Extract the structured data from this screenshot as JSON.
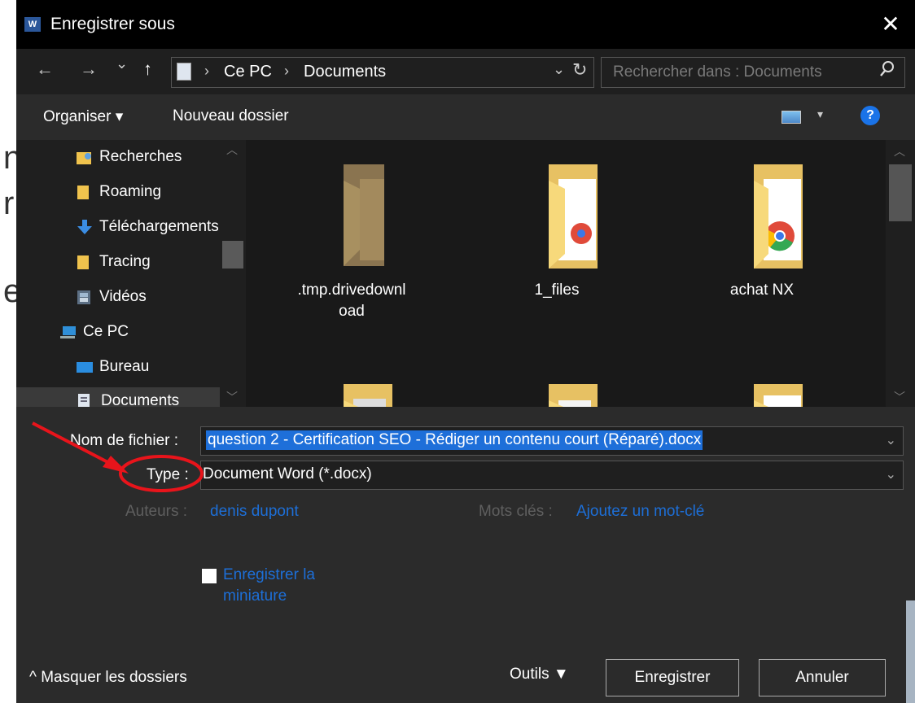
{
  "background": {
    "fragments": [
      "n",
      "r",
      "e"
    ]
  },
  "window": {
    "app_icon_text": "W",
    "title": "Enregistrer sous",
    "close": "✕"
  },
  "nav": {
    "back": "←",
    "forward": "→",
    "recent": "⌄",
    "up": "↑",
    "breadcrumb": [
      "Ce PC",
      "Documents"
    ],
    "sep": "›",
    "dropdown": "⌄",
    "refresh": "↻",
    "search_placeholder": "Rechercher dans : Documents",
    "search_icon": "⚲"
  },
  "toolbar": {
    "organize": "Organiser ▾",
    "new_folder": "Nouveau dossier",
    "view_dropdown": "▾",
    "help": "?"
  },
  "sidebar": {
    "items": [
      {
        "label": "Recherches",
        "icon": "search-folder-icon"
      },
      {
        "label": "Roaming",
        "icon": "folder-icon"
      },
      {
        "label": "Téléchargements",
        "icon": "download-icon"
      },
      {
        "label": "Tracing",
        "icon": "folder-icon"
      },
      {
        "label": "Vidéos",
        "icon": "videos-icon"
      },
      {
        "label": "Ce PC",
        "icon": "computer-icon"
      },
      {
        "label": "Bureau",
        "icon": "desktop-icon"
      },
      {
        "label": "Documents",
        "icon": "documents-icon"
      }
    ]
  },
  "files": [
    {
      "name": ".tmp.drivedownl",
      "name2": "oad"
    },
    {
      "name": "1_files",
      "name2": ""
    },
    {
      "name": "achat NX",
      "name2": ""
    },
    {
      "name": "",
      "name2": ""
    },
    {
      "name": "",
      "name2": ""
    },
    {
      "name": "",
      "name2": ""
    }
  ],
  "form": {
    "filename_label": "Nom de fichier :",
    "filename_value": "question 2 - Certification SEO - Rédiger un contenu court (Réparé).docx",
    "type_label": "Type :",
    "type_value": "Document Word (*.docx)",
    "authors_label": "Auteurs :",
    "authors_value": "denis dupont",
    "keywords_label": "Mots clés :",
    "keywords_value": "Ajoutez un mot-clé",
    "thumbnail_line1": "Enregistrer la",
    "thumbnail_line2": "miniature",
    "dropdown_arrow": "⌄"
  },
  "footer": {
    "hide_folders": "^ Masquer les dossiers",
    "tools": "Outils ▼",
    "save": "Enregistrer",
    "cancel": "Annuler"
  },
  "colors": {
    "selection": "#1e6fd9",
    "annotation": "#e8141b",
    "link": "#1d6fd8"
  }
}
